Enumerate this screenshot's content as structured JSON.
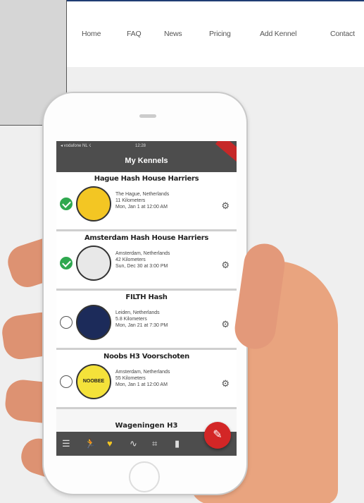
{
  "nav": {
    "items": [
      "Home",
      "FAQ",
      "News",
      "Pricing",
      "Add Kennel",
      "Contact"
    ]
  },
  "app": {
    "status_left": "◂ vodafone NL ☇",
    "status_time": "12:28",
    "title": "My Kennels",
    "kennels": [
      {
        "name": "Hague Hash House Harriers",
        "location": "The Hague, Netherlands",
        "distance": "11 Kilometers",
        "next_run": "Mon, Jan 1 at 12:00 AM",
        "selected": true,
        "logo_color": "#f3c623"
      },
      {
        "name": "Amsterdam Hash House Harriers",
        "location": "Amsterdam, Netherlands",
        "distance": "42 Kilometers",
        "next_run": "Sun, Dec 30 at 3:00 PM",
        "selected": true,
        "logo_color": "#e8e8e8"
      },
      {
        "name": "FILTH Hash",
        "location": "Leiden, Netherlands",
        "distance": "5.8 Kilometers",
        "next_run": "Mon, Jan 21 at 7:30 PM",
        "selected": false,
        "logo_color": "#1c2b5a"
      },
      {
        "name": "Noobs H3 Voorschoten",
        "location": "Amsterdam, Netherlands",
        "distance": "55 Kilometers",
        "next_run": "Mon, Jan 1 at 12:00 AM",
        "selected": false,
        "logo_color": "#f4e23a",
        "logo_text": "NOOBEE"
      }
    ],
    "peek_title": "Wageningen H3",
    "bottom_icons": [
      "menu-icon",
      "runner-icon",
      "trophy-icon",
      "chart-icon",
      "qr-icon",
      "beer-icon"
    ],
    "fab_icon": "torch-icon"
  },
  "colors": {
    "accent_red": "#d32626",
    "check_green": "#2fa84f",
    "bar_gray": "#4d4d4d",
    "nav_border": "#1f3c73"
  }
}
